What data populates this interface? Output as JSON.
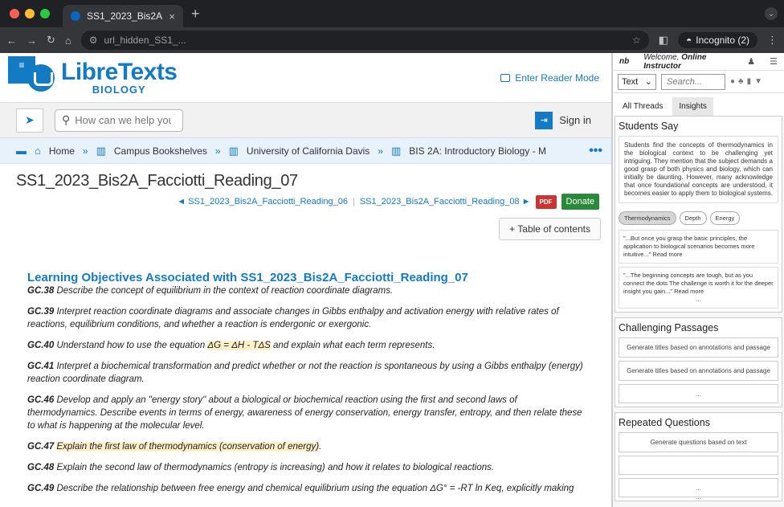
{
  "browser": {
    "tab_title": "SS1_2023_Bis2A_Facciotti_Reading_07",
    "address": "url_hidden_SS1_...",
    "incognito": "Incognito (2)"
  },
  "site": {
    "logo_main": "LibreTexts",
    "logo_sub": "BIOLOGY",
    "reader_mode": "Enter Reader Mode",
    "search_placeholder": "How can we help you?",
    "sign_in": "Sign in",
    "breadcrumb": [
      "Home",
      "Campus Bookshelves",
      "University of California Davis",
      "BIS 2A: Introductory Biology - M"
    ]
  },
  "page": {
    "title": "SS1_2023_Bis2A_Facciotti_Reading_07",
    "prev": "◄ SS1_2023_Bis2A_Facciotti_Reading_06",
    "next": "SS1_2023_Bis2A_Facciotti_Reading_08 ►",
    "pdf": "PDF",
    "donate": "Donate",
    "toc": "+ Table of contents",
    "lo_heading": "Learning Objectives Associated with SS1_2023_Bis2A_Facciotti_Reading_07",
    "objectives": [
      {
        "code": "GC.38",
        "text": " Describe the concept of equilibrium in the context of reaction coordinate diagrams."
      },
      {
        "code": "GC.39",
        "text": " Interpret reaction coordinate diagrams and associate changes in Gibbs enthalpy and activation energy with relative rates of reactions, equilibrium conditions, and whether a reaction is endergonic or exergonic."
      },
      {
        "code": "GC.40",
        "pre": " Understand how to use the equation ",
        "hl": "ΔG = ΔH - TΔS",
        "text": " and explain what each term represents."
      },
      {
        "code": "GC.41",
        "text": " Interpret a biochemical transformation and predict whether or not the reaction is spontaneous by using a Gibbs enthalpy (energy) reaction coordinate diagram."
      },
      {
        "code": "GC.46",
        "text": " Develop and apply an \"energy story\" about a biological or biochemical reaction using the first and second laws of thermodynamics. Describe events in terms of energy, awareness of energy conservation, energy transfer, entropy, and then relate these to what is happening at the molecular level."
      },
      {
        "code": "GC.47",
        "pre": " ",
        "hl": "Explain the first law of thermodynamics (conservation of energy)",
        "text": "."
      },
      {
        "code": "GC.48",
        "text": " Explain the second law of thermodynamics (entropy is increasing) and how it relates to biological reactions."
      },
      {
        "code": "GC.49",
        "text": " Describe the relationship between free energy and chemical equilibrium using the equation ΔG° = -RT ln Keq, explicitly making"
      }
    ]
  },
  "nb": {
    "logo": "nb",
    "welcome_pre": "Welcome, ",
    "welcome_name": "Online Instructor",
    "filter_value": "Text",
    "search_placeholder": "Search...",
    "tabs": [
      "All Threads",
      "Insights"
    ],
    "students_say": "Students Say",
    "summary": "Students find the concepts of thermodynamics in the biological context to be challenging yet intriguing. They mention that the subject demands a good grasp of both physics and biology, which can initially be daunting. However, many acknowledge that once foundational concepts are understood, it becomes easier to apply them to biological systems.",
    "chips": [
      "Thermodynamics",
      "Depth",
      "Energy"
    ],
    "quotes": [
      "\"...But once you grasp the basic principles, the application to biological scenarios becomes more intuitive...\" Read more",
      "\"...The beginning concepts are tough, but as you connect the dots The challenge is worth it for the deeper insight you gain...\" Read more"
    ],
    "dots": "...",
    "challenging": "Challenging Passages",
    "gen_titles": "Generate titles based on annotations and passage",
    "repeated": "Repeated Questions",
    "gen_questions": "Generate questions based on text"
  }
}
